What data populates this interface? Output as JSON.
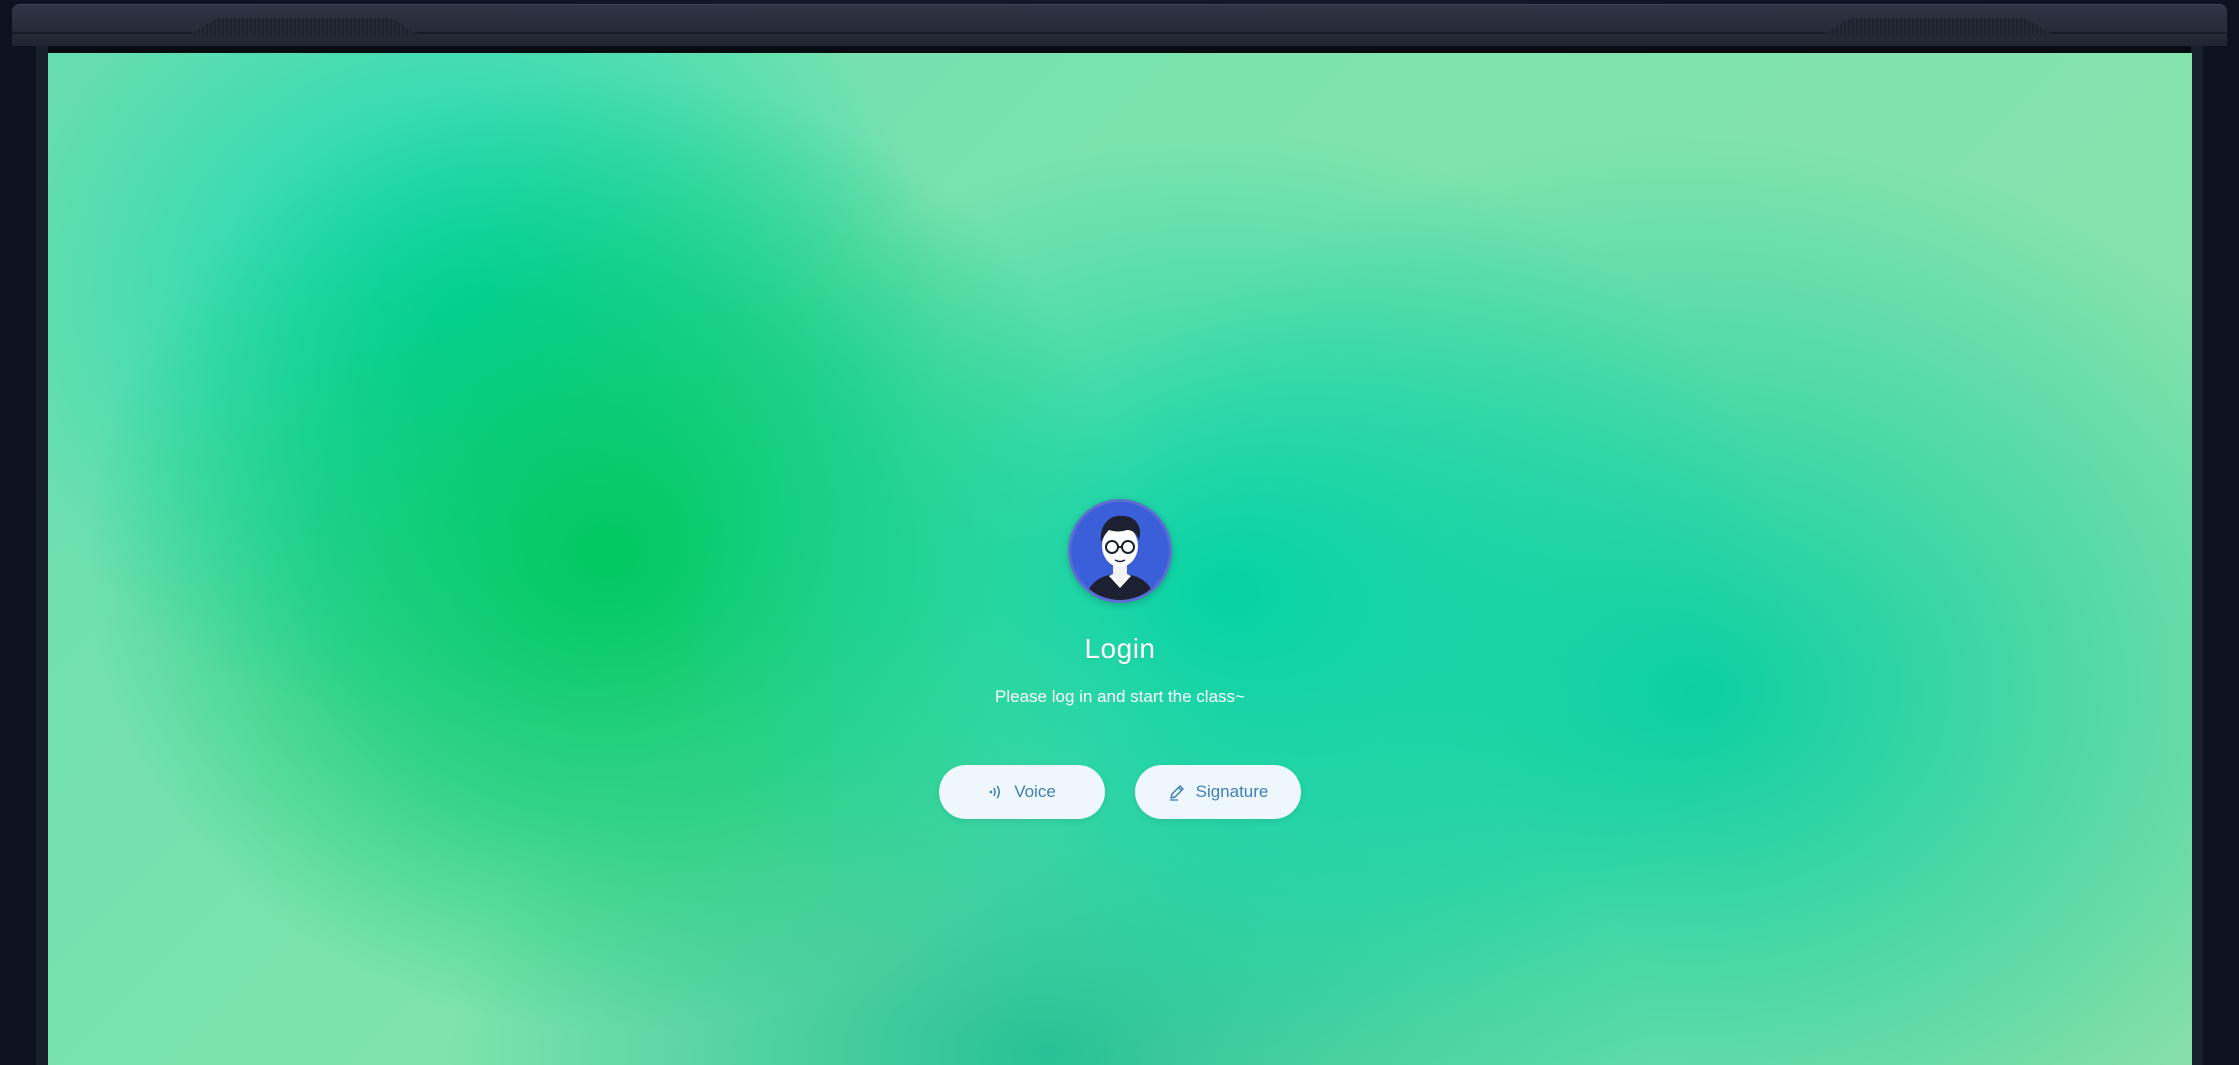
{
  "login": {
    "title": "Login",
    "subtitle": "Please log in and start the class~",
    "buttons": [
      {
        "label": "Voice",
        "icon": "voice-wave-icon"
      },
      {
        "label": "Signature",
        "icon": "pen-icon"
      }
    ]
  },
  "colors": {
    "button_bg": "#eef7fb",
    "button_text": "#3f7fb8",
    "avatar_bg": "#3a5fd8",
    "background_green": "#00c868",
    "background_teal": "#00d4a8"
  },
  "avatar": {
    "icon": "user-avatar-icon"
  }
}
